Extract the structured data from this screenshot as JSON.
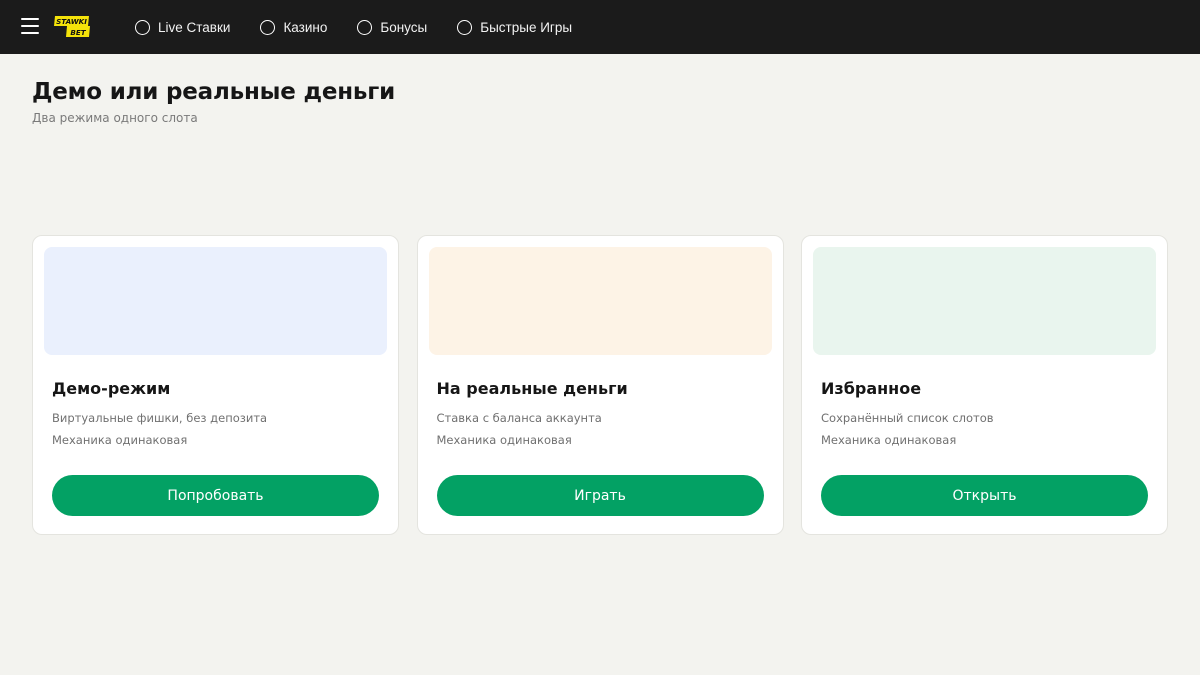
{
  "colors": {
    "topbar_bg": "#1b1b1b",
    "page_bg": "#f3f3ef",
    "accent": "#03a164",
    "logo_yellow": "#f5e30a"
  },
  "header": {
    "menu_icon": "hamburger-icon",
    "logo": {
      "line1": "STAWKI",
      "line2": "BET"
    },
    "nav": [
      {
        "label": "Live Ставки",
        "icon": "circle-icon"
      },
      {
        "label": "Казино",
        "icon": "circle-icon"
      },
      {
        "label": "Бонусы",
        "icon": "circle-icon"
      },
      {
        "label": "Быстрые Игры",
        "icon": "circle-icon"
      }
    ]
  },
  "page": {
    "title": "Демо или реальные деньги",
    "subtitle": "Два режима одного слота"
  },
  "cards": [
    {
      "title": "Демо-режим",
      "line1": "Виртуальные фишки, без депозита",
      "line2": "Механика одинаковая",
      "button": "Попробовать",
      "banner_color": "#eaf0fd"
    },
    {
      "title": "На реальные деньги",
      "line1": "Ставка с баланса аккаунта",
      "line2": "Механика одинаковая",
      "button": "Играть",
      "banner_color": "#fdf3e6"
    },
    {
      "title": "Избранное",
      "line1": "Сохранённый список слотов",
      "line2": "Механика одинаковая",
      "button": "Открыть",
      "banner_color": "#e9f5ee"
    }
  ]
}
